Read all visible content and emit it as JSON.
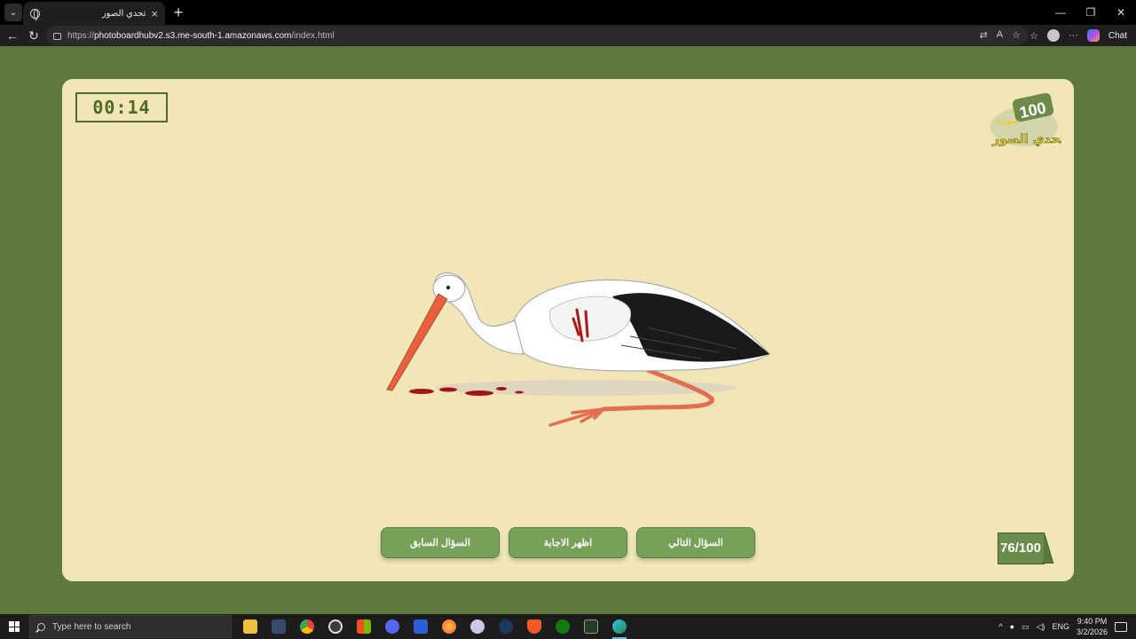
{
  "browser": {
    "tab_title": "تحدي الصور",
    "url_prefix": "https://",
    "url_host": "photoboardhubv2.s3.me-south-1.amazonaws.com",
    "url_path": "/index.html",
    "chat_label": "Chat"
  },
  "game": {
    "timer": "00:14",
    "counter": "76/100",
    "buttons": {
      "prev": "السؤال السابق",
      "show_answer": "اظهر الاجابة",
      "next": "السؤال التالي"
    },
    "logo": {
      "number": "100",
      "word_image": "صورة",
      "word_title": "تحدي الصور"
    },
    "colors": {
      "background": "#5d7a3c",
      "card": "#f2e6b6",
      "accent": "#4e6b2a",
      "button": "#77a058"
    }
  },
  "taskbar": {
    "search_placeholder": "Type here to search",
    "language": "ENG",
    "time": "9:40 PM",
    "date": "3/2/2026"
  }
}
